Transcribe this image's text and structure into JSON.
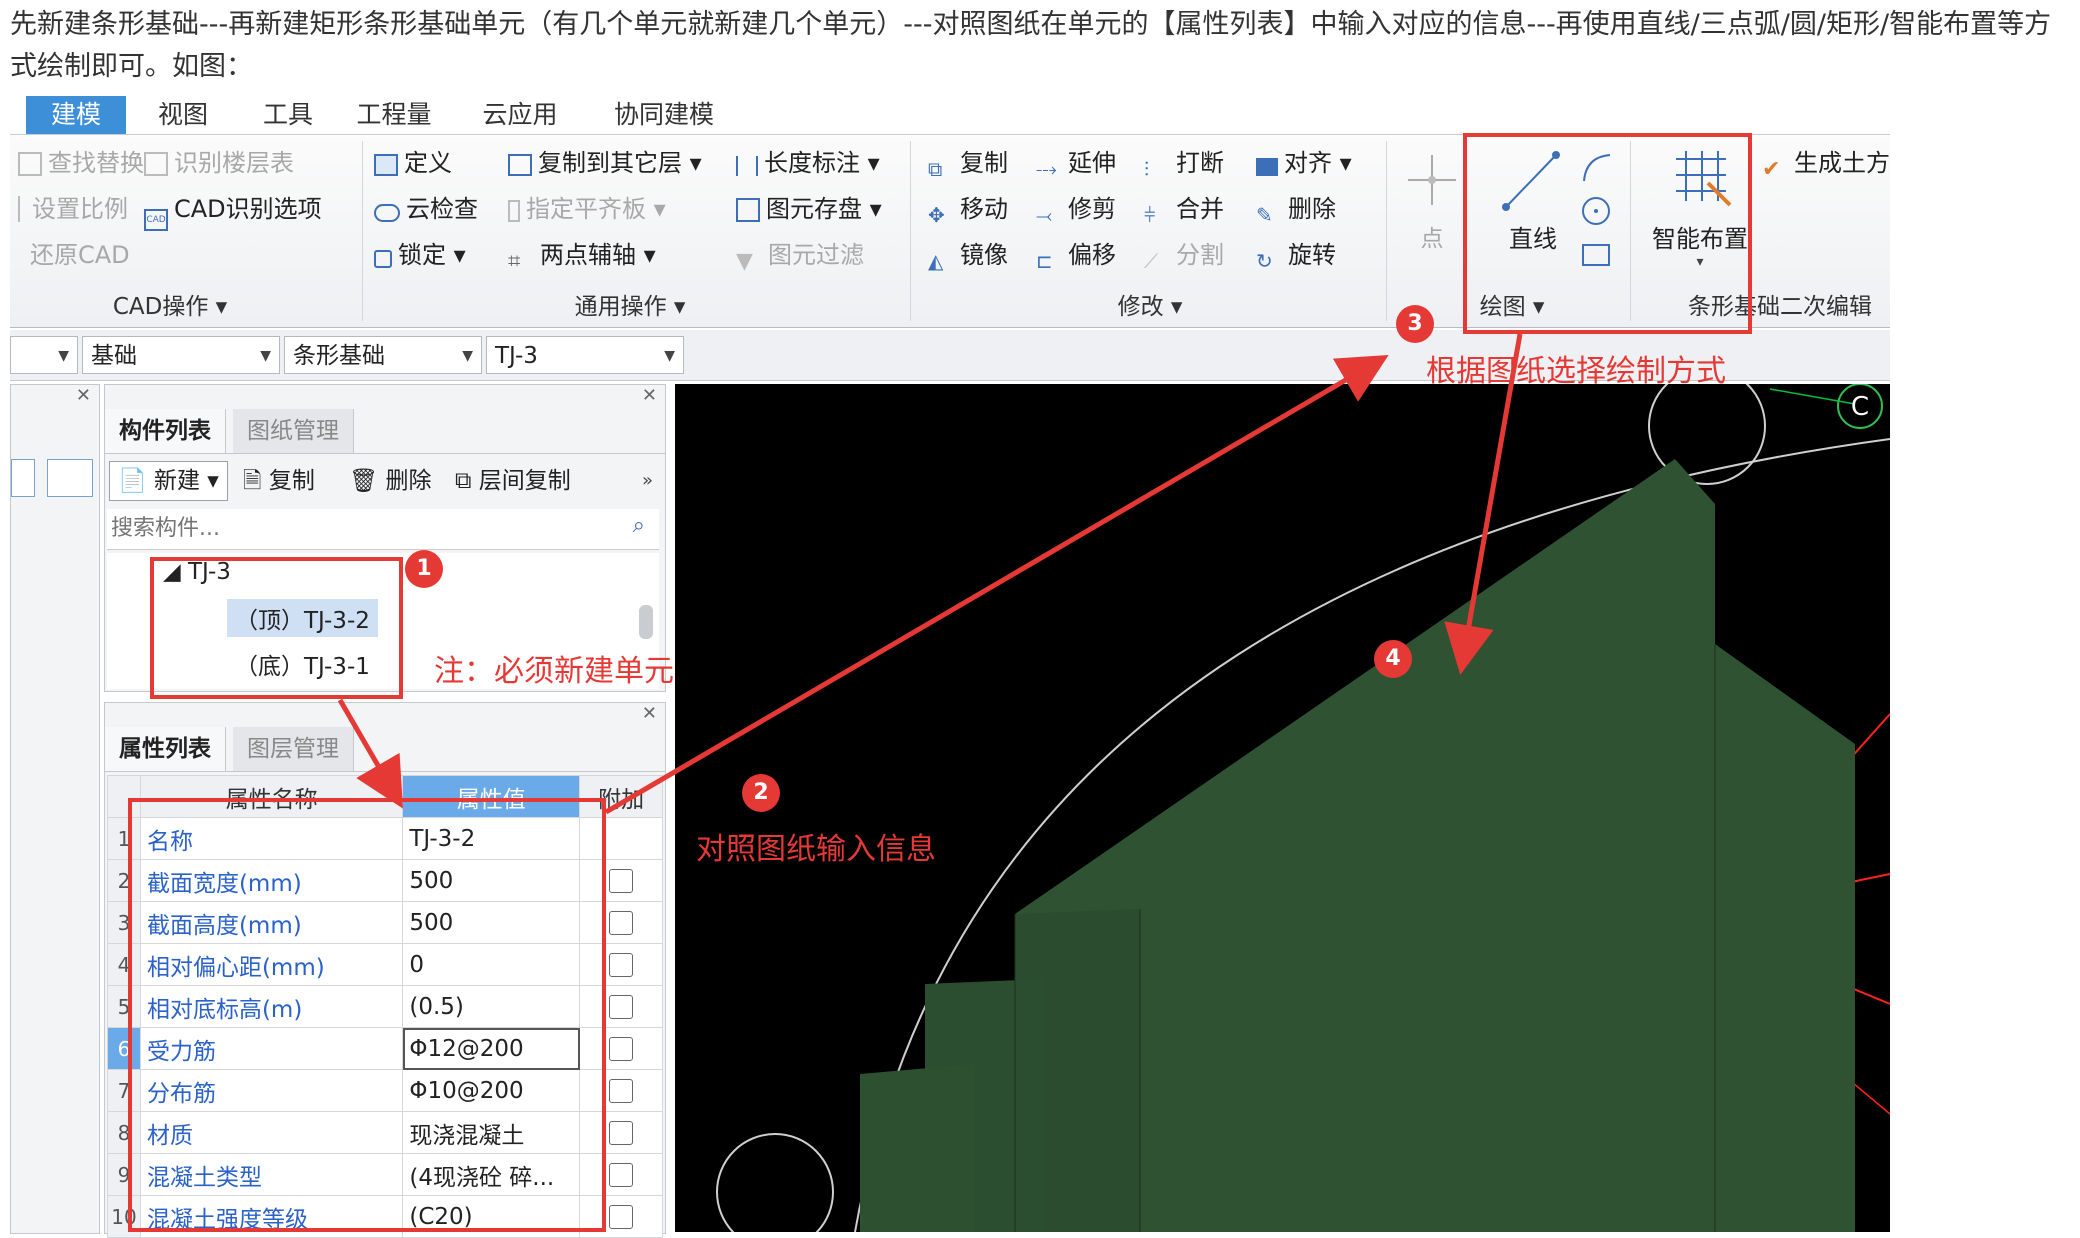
{
  "intro_text": "先新建条形基础---再新建矩形条形基础单元（有几个单元就新建几个单元）---对照图纸在单元的【属性列表】中输入对应的信息---再使用直线/三点弧/圆/矩形/智能布置等方式绘制即可。如图：",
  "tabs": [
    "建模",
    "视图",
    "工具",
    "工程量",
    "云应用",
    "协同建模"
  ],
  "ribbon": {
    "cad_ops": {
      "find_replace": "查找替换",
      "identify_floors": "识别楼层表",
      "set_scale": "设置比例",
      "cad_options": "CAD识别选项",
      "restore_cad": "还原CAD",
      "group": "CAD操作"
    },
    "common_ops": {
      "define": "定义",
      "copy_to_layer": "复制到其它层",
      "dimension": "长度标注",
      "cloud_check": "云检查",
      "set_slab": "指定平齐板",
      "save_element": "图元存盘",
      "lock": "锁定",
      "two_point_aux": "两点辅轴",
      "filter": "图元过滤",
      "group": "通用操作"
    },
    "modify": {
      "copy": "复制",
      "extend": "延伸",
      "break": "打断",
      "align": "对齐",
      "move": "移动",
      "trim": "修剪",
      "merge": "合并",
      "delete": "删除",
      "mirror": "镜像",
      "offset": "偏移",
      "split": "分割",
      "rotate": "旋转",
      "group": "修改"
    },
    "draw": {
      "point": "点",
      "line": "直线",
      "group": "绘图"
    },
    "strip": {
      "smart_place": "智能布置",
      "gen_earthwork": "生成土方",
      "group": "条形基础二次编辑"
    }
  },
  "selectors": [
    "基础",
    "条形基础",
    "TJ-3"
  ],
  "component_panel": {
    "tabs": [
      "构件列表",
      "图纸管理"
    ],
    "toolbar": {
      "new": "新建",
      "copy": "复制",
      "delete": "删除",
      "layer_copy": "层间复制"
    },
    "search_placeholder": "搜索构件...",
    "tree": {
      "root": "TJ-3",
      "children": [
        "（顶）TJ-3-2",
        "（底）TJ-3-1"
      ]
    }
  },
  "property_panel": {
    "tabs": [
      "属性列表",
      "图层管理"
    ],
    "headers": [
      "属性名称",
      "属性值",
      "附加"
    ],
    "rows": [
      {
        "num": "1",
        "name": "名称",
        "value": "TJ-3-2",
        "check": false
      },
      {
        "num": "2",
        "name": "截面宽度(mm)",
        "value": "500",
        "check": true
      },
      {
        "num": "3",
        "name": "截面高度(mm)",
        "value": "500",
        "check": true
      },
      {
        "num": "4",
        "name": "相对偏心距(mm)",
        "value": "0",
        "check": true
      },
      {
        "num": "5",
        "name": "相对底标高(m)",
        "value": "(0.5)",
        "check": true
      },
      {
        "num": "6",
        "name": "受力筋",
        "value": "Φ12@200",
        "check": true
      },
      {
        "num": "7",
        "name": "分布筋",
        "value": "Φ10@200",
        "check": true
      },
      {
        "num": "8",
        "name": "材质",
        "value": "现浇混凝土",
        "check": true
      },
      {
        "num": "9",
        "name": "混凝土类型",
        "value": "(4现浇砼 碎...",
        "check": true
      },
      {
        "num": "10",
        "name": "混凝土强度等级",
        "value": "(C20)",
        "check": true
      }
    ]
  },
  "annotations": {
    "badge1": "1",
    "badge2": "2",
    "badge3": "3",
    "badge4": "4",
    "note1": "注：必须新建单元",
    "note2": "对照图纸输入信息",
    "note3": "根据图纸选择绘制方式"
  },
  "canvas_marker": "C",
  "colors": {
    "accent": "#3d8fd7",
    "annotation_red": "#e53935",
    "footing_green": "#2f5233",
    "canvas_bg": "#000000"
  }
}
